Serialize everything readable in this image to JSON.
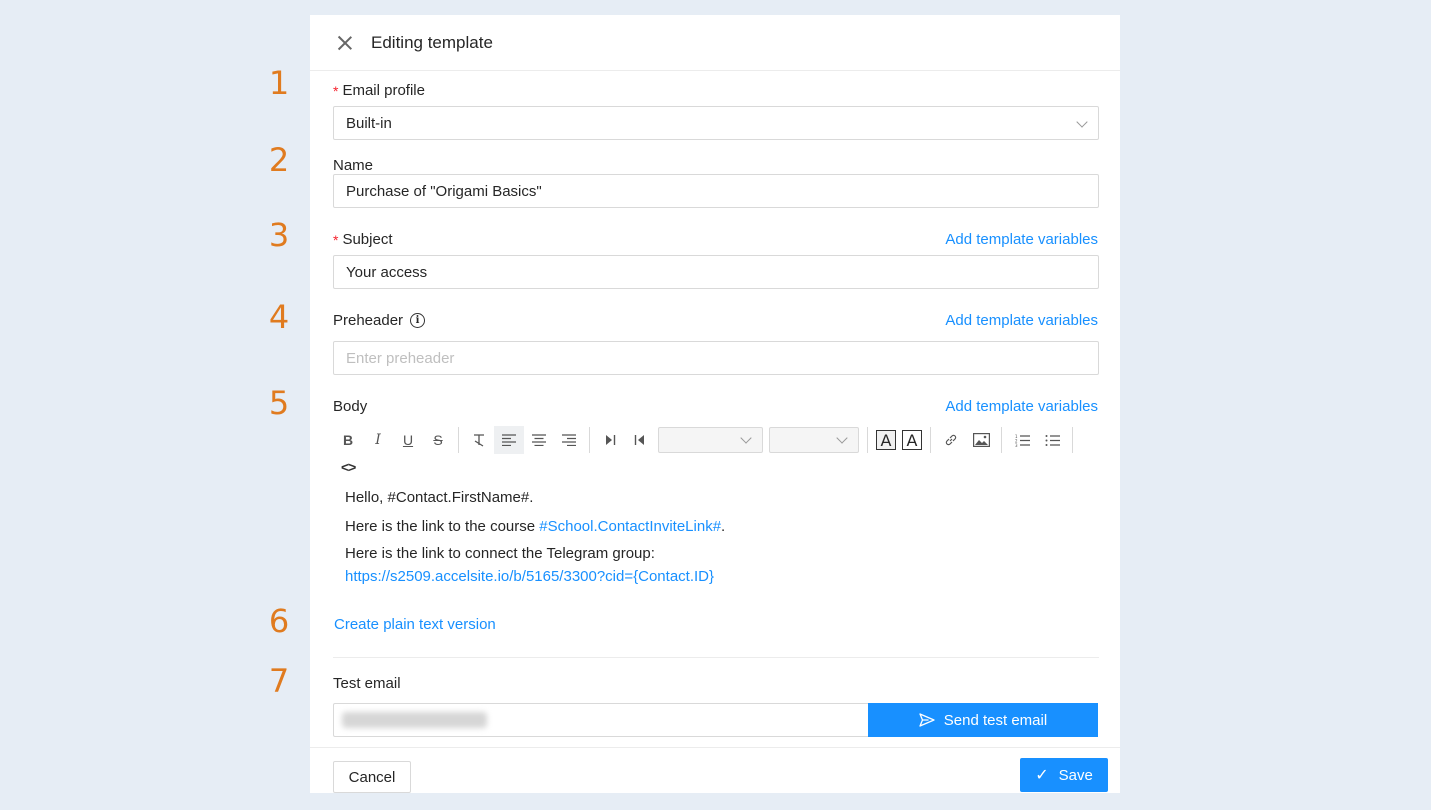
{
  "steps": [
    "1",
    "2",
    "3",
    "4",
    "5",
    "6",
    "7"
  ],
  "header": {
    "title": "Editing template"
  },
  "email_profile": {
    "label": "Email profile",
    "value": "Built-in"
  },
  "name_field": {
    "label": "Name",
    "value": "Purchase of \"Origami Basics\""
  },
  "subject": {
    "label": "Subject",
    "value": "Your access",
    "link": "Add template variables"
  },
  "preheader": {
    "label": "Preheader",
    "placeholder": "Enter preheader",
    "link": "Add template variables"
  },
  "body": {
    "label": "Body",
    "link": "Add template variables",
    "toolbar": {
      "bold": "B",
      "italic": "I",
      "underline": "U",
      "strike": "S",
      "fore_color": "A",
      "back_color": "A",
      "code": "<>"
    },
    "line1": "Hello, #Contact.FirstName#.",
    "line2_prefix": "Here is the link to the course ",
    "line2_link": "#School.ContactInviteLink#",
    "line2_suffix": ".",
    "line3": "Here is the link to connect the Telegram group:",
    "line4_link": "https://s2509.accelsite.io/b/5165/3300?cid={Contact.ID}"
  },
  "plain_text_link": "Create plain text version",
  "test_email": {
    "label": "Test email",
    "button": "Send test email"
  },
  "footer": {
    "cancel": "Cancel",
    "save": "Save"
  },
  "colors": {
    "accent": "#1890ff",
    "step": "#e07b1f",
    "required": "#f5222d"
  }
}
